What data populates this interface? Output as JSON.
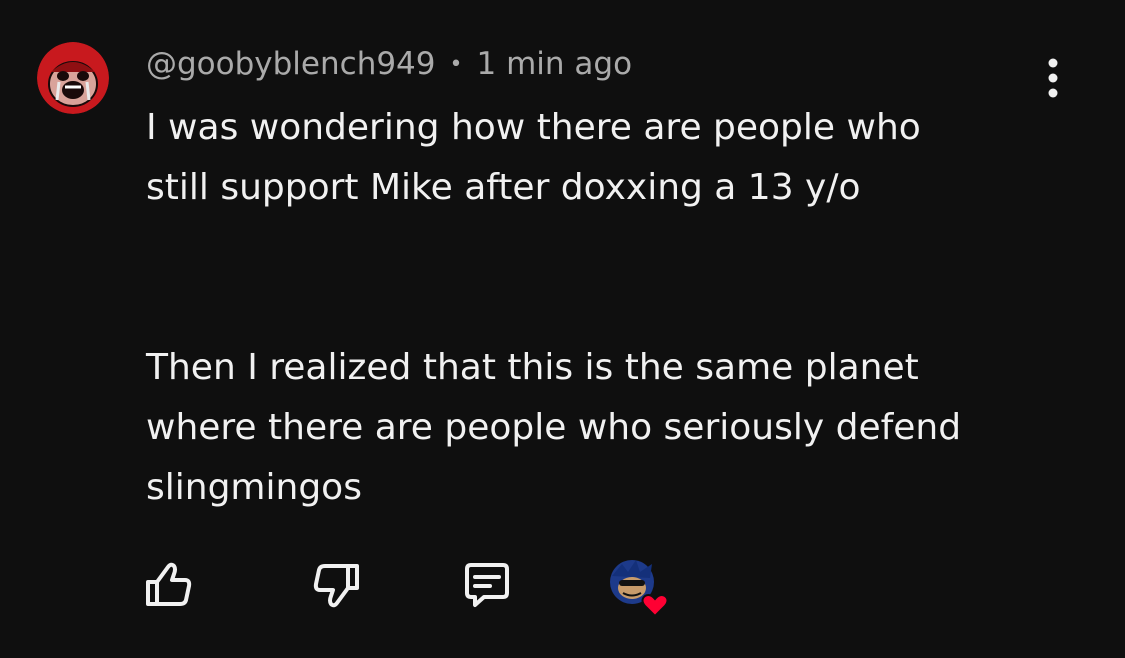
{
  "comment": {
    "username": "@goobyblench949",
    "separator": "•",
    "timestamp": "1 min ago",
    "paragraphs": [
      "I was wondering how there are people who\nstill support Mike after doxxing a 13 y/o",
      "Then I realized that this is the same planet\nwhere there are people who seriously defend\nslingmingos"
    ]
  },
  "icons": {
    "avatar": "crying-face-avatar",
    "more": "more-vertical-icon",
    "like": "thumbs-up-icon",
    "dislike": "thumbs-down-icon",
    "reply": "reply-comment-icon",
    "creator_heart": "creator-heart-badge"
  },
  "colors": {
    "background": "#0f0f0f",
    "text": "#f1f1f1",
    "meta_text": "#aaaaaa",
    "heart": "#ff0033",
    "avatar_red": "#c8191e"
  }
}
